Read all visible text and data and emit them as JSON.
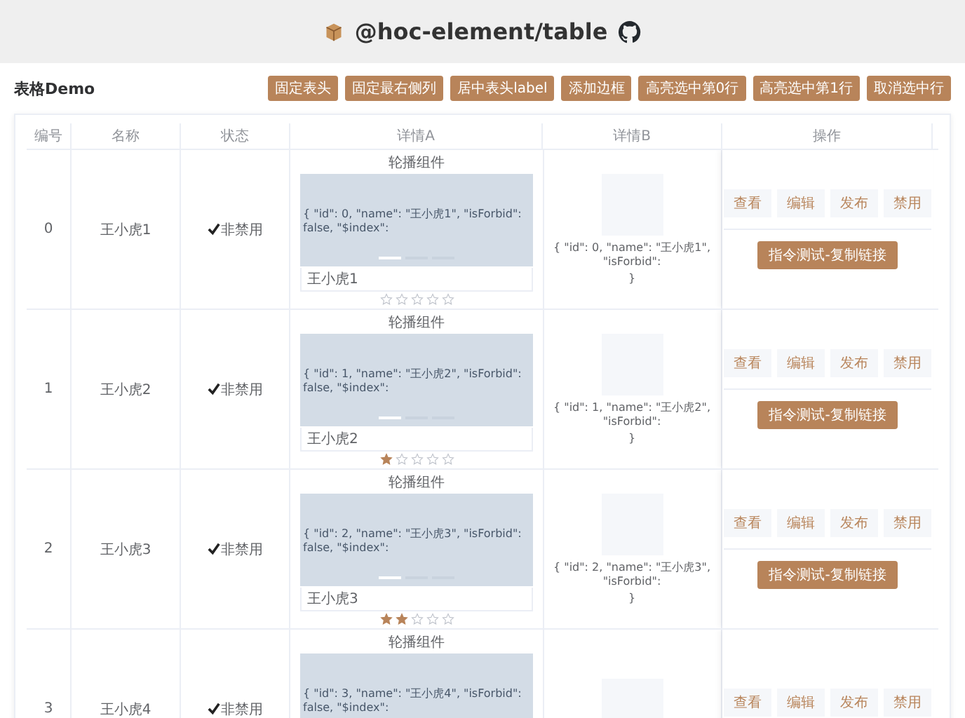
{
  "header": {
    "title": "@hoc-element/table"
  },
  "toolbar": {
    "title": "表格Demo",
    "buttons": [
      "固定表头",
      "固定最右侧列",
      "居中表头label",
      "添加边框",
      "高亮选中第0行",
      "高亮选中第1行",
      "取消选中行"
    ]
  },
  "table": {
    "columns": [
      "编号",
      "名称",
      "状态",
      "详情A",
      "详情B",
      "操作"
    ],
    "rows": [
      {
        "id": "0",
        "name": "王小虎1",
        "status": "非禁用",
        "carousel_label": "轮播组件",
        "carousel_text": "{ \"id\": 0, \"name\": \"王小虎1\", \"isForbid\": false, \"$index\":",
        "indicators": [
          {
            "selected": true
          },
          {
            "selected": false
          },
          {
            "selected": false
          }
        ],
        "caption": "王小虎1",
        "stars": 0,
        "detail_b": [
          "{ \"id\": 0, \"name\": \"王小虎1\", \"isForbid\":",
          "}"
        ],
        "actions": [
          "查看",
          "编辑",
          "发布",
          "禁用"
        ],
        "command": "指令测试-复制链接"
      },
      {
        "id": "1",
        "name": "王小虎2",
        "status": "非禁用",
        "carousel_label": "轮播组件",
        "carousel_text": "{ \"id\": 1, \"name\": \"王小虎2\", \"isForbid\": false, \"$index\":",
        "indicators": [
          {
            "selected": true
          },
          {
            "selected": false
          },
          {
            "selected": false
          }
        ],
        "caption": "王小虎2",
        "stars": 1,
        "detail_b": [
          "{ \"id\": 1, \"name\": \"王小虎2\", \"isForbid\":",
          "}"
        ],
        "actions": [
          "查看",
          "编辑",
          "发布",
          "禁用"
        ],
        "command": "指令测试-复制链接"
      },
      {
        "id": "2",
        "name": "王小虎3",
        "status": "非禁用",
        "carousel_label": "轮播组件",
        "carousel_text": "{ \"id\": 2, \"name\": \"王小虎3\", \"isForbid\": false, \"$index\":",
        "indicators": [
          {
            "selected": true
          },
          {
            "selected": false
          },
          {
            "selected": false
          }
        ],
        "caption": "王小虎3",
        "stars": 2,
        "detail_b": [
          "{ \"id\": 2, \"name\": \"王小虎3\", \"isForbid\":",
          "}"
        ],
        "actions": [
          "查看",
          "编辑",
          "发布",
          "禁用"
        ],
        "command": "指令测试-复制链接"
      },
      {
        "id": "3",
        "name": "王小虎4",
        "status": "非禁用",
        "carousel_label": "轮播组件",
        "carousel_text": "{ \"id\": 3, \"name\": \"王小虎4\", \"isForbid\": false, \"$index\":",
        "actions": [
          "查看",
          "编辑",
          "发布",
          "禁用"
        ]
      }
    ]
  }
}
